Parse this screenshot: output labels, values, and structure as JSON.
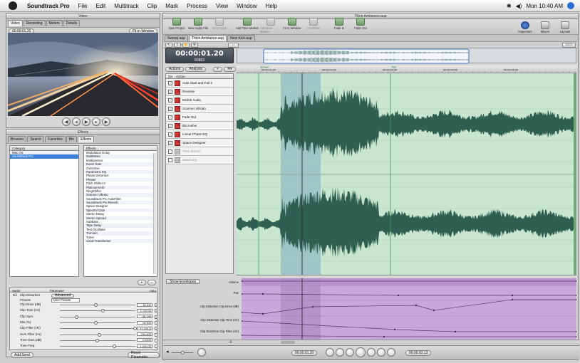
{
  "menubar": {
    "app": "Soundtrack Pro",
    "items": [
      "File",
      "Edit",
      "Multitrack",
      "Clip",
      "Mark",
      "Process",
      "View",
      "Window",
      "Help"
    ],
    "clock": "Mon 10:40 AM"
  },
  "video": {
    "title": "Video",
    "tabs": [
      "Video",
      "Recording",
      "Meters",
      "Details"
    ],
    "timecode": "00:00:01.20",
    "fit": "Fit in Window"
  },
  "effects": {
    "title": "Effects",
    "tabs": [
      "Browser",
      "Search",
      "Favorites",
      "Bin",
      "Effects"
    ],
    "category_header": "Category",
    "categories": [
      "Mac OS",
      "Soundtrack Pro"
    ],
    "effects_header": "Effects",
    "effect_list": [
      "Modulation Delay",
      "MultiMeter",
      "Multipressor",
      "Noise Gate",
      "Overdrive",
      "Parametric EQ",
      "Phase Distortion",
      "Phaser",
      "Pitch Shifter II",
      "PlatinumVerb",
      "RingShifter",
      "Scanner Vibrato",
      "Soundtrack Pro AutoFilter",
      "Soundtrack Pro Reverb",
      "Space Designer",
      "Spectral Gate",
      "Stereo Delay",
      "Stereo Spread",
      "SubBass",
      "Tape Delay",
      "Test Oscillator",
      "Tremolo",
      "Tuner",
      "Vocal Transformer"
    ]
  },
  "params": {
    "col_name": "Name",
    "col_param": "Parameter",
    "col_auto": "Auto",
    "plugin": "Clip Distortion",
    "advanced": "Advanced",
    "presets_label": "Presets",
    "presets_value": "User Presets",
    "rows": [
      {
        "label": "Clip Drive (dB)",
        "value": "15.611",
        "checked": "✓"
      },
      {
        "label": "Clip Tone (Hz)",
        "value": "1,110.00",
        "checked": "✓"
      },
      {
        "label": "Clip Sym.",
        "value": "-36.149",
        "checked": "✓"
      },
      {
        "label": "Mix (%)",
        "value": "18.000",
        "checked": ""
      },
      {
        "label": "Clip Filter (Hz)",
        "value": "17,221.0",
        "checked": "✓"
      },
      {
        "label": "Sum Filter (Hz)",
        "value": "750.000",
        "checked": ""
      },
      {
        "label": "Tone Gain (dB)",
        "value": "0.0000",
        "checked": ""
      },
      {
        "label": "Tone Freq.",
        "value": "1,100.00",
        "checked": ""
      }
    ],
    "add_send": "Add Send",
    "reset": "Reset Parameter"
  },
  "main": {
    "title": "Thick Ambiance.aup",
    "toolbar": [
      {
        "label": "New Project",
        "dim": false
      },
      {
        "label": "New Audio File",
        "dim": false
      },
      {
        "label": "New Track",
        "dim": true
      },
      {
        "label": "Add Time Marker",
        "dim": false
      },
      {
        "label": "Add Beat Marker",
        "dim": true
      },
      {
        "label": "Fit in Window",
        "dim": false
      },
      {
        "label": "Crossfade",
        "dim": true
      },
      {
        "label": "Fade In",
        "dim": false
      },
      {
        "label": "Fade Out",
        "dim": false
      }
    ],
    "toolbar_right": [
      "Inspectors",
      "Mixers",
      "Layouts"
    ],
    "doc_tabs": [
      "Sweep.aup",
      "Thick Ambiance.aup",
      "New Kick.aup"
    ],
    "timecode": "00:00:01.20",
    "samples": "80953",
    "actions_tab": "Actions",
    "analysis_tab": "Analysis",
    "on_label": "On",
    "action_label": "Action",
    "actions": [
      {
        "label": "Auto Start and Fall 2",
        "dim": false
      },
      {
        "label": "Reverse",
        "dim": false
      },
      {
        "label": "Delete Audio",
        "dim": false
      },
      {
        "label": "Scanner Vibrato",
        "dim": false
      },
      {
        "label": "Fade Out",
        "dim": false
      },
      {
        "label": "Bitcrusher",
        "dim": false
      },
      {
        "label": "Linear Phase EQ",
        "dim": false
      },
      {
        "label": "Space Designer",
        "dim": false
      },
      {
        "label": "Time Stretch",
        "dim": true
      },
      {
        "label": "Match EQ",
        "dim": true
      }
    ],
    "ruler": [
      "00:00:01:00",
      "00:00:02:00",
      "00:00:03:00",
      "00:00:04:00",
      "00:00:05:00"
    ],
    "markers": [
      "Scream",
      "Fall"
    ],
    "show_envelopes": "Show Envelopes",
    "envelope_labels": [
      "Volume",
      "Pan",
      "Clip Distortion Clip Drive (dB)",
      "Clip Distortion Clip Tone (Hz)",
      "Clip Distortion Clip Filter (Hz)"
    ],
    "bottom_timecode_left": "00:00:01.20",
    "bottom_timecode_right": "00:00:03.13",
    "zoom": "-1"
  },
  "colors": {
    "wave": "#2f5f50",
    "wave_bg": "#c7e5cf",
    "selection": "#9fc5c7",
    "envelope_bg": "#c8a8d8",
    "playhead": "#333333"
  }
}
